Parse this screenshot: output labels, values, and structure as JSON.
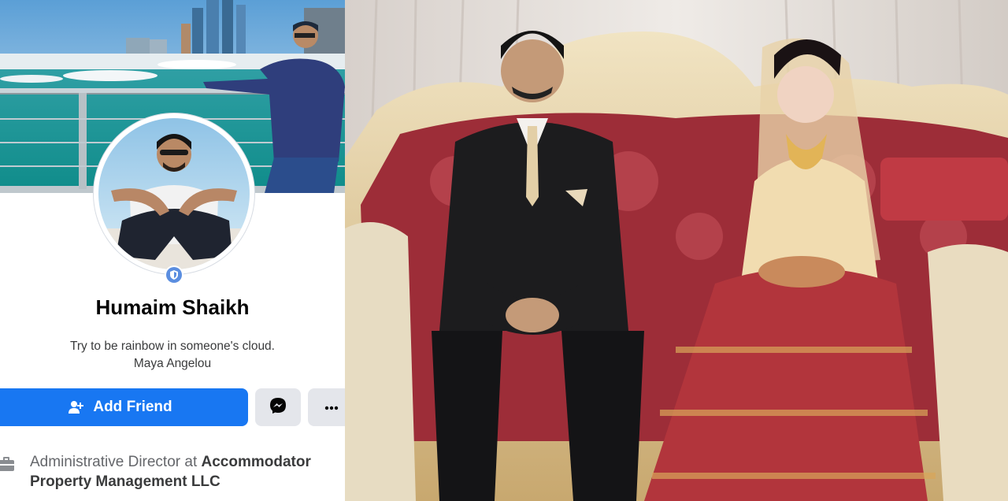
{
  "profile": {
    "name": "Humaim Shaikh",
    "bio_line1": "Try to be rainbow in someone's cloud.",
    "bio_line2": "Maya Angelou",
    "work_prefix": "Administrative Director at ",
    "work_company_line1": "Accommodator",
    "work_company_line2": "Property Management LLC"
  },
  "actions": {
    "add_friend": "Add Friend",
    "messenger_icon": "messenger-icon",
    "more_icon": "more-dots-icon"
  },
  "colors": {
    "accent": "#1877f2",
    "secondary_button": "#e4e6eb",
    "text_primary": "#050505",
    "text_secondary": "#65676b"
  }
}
